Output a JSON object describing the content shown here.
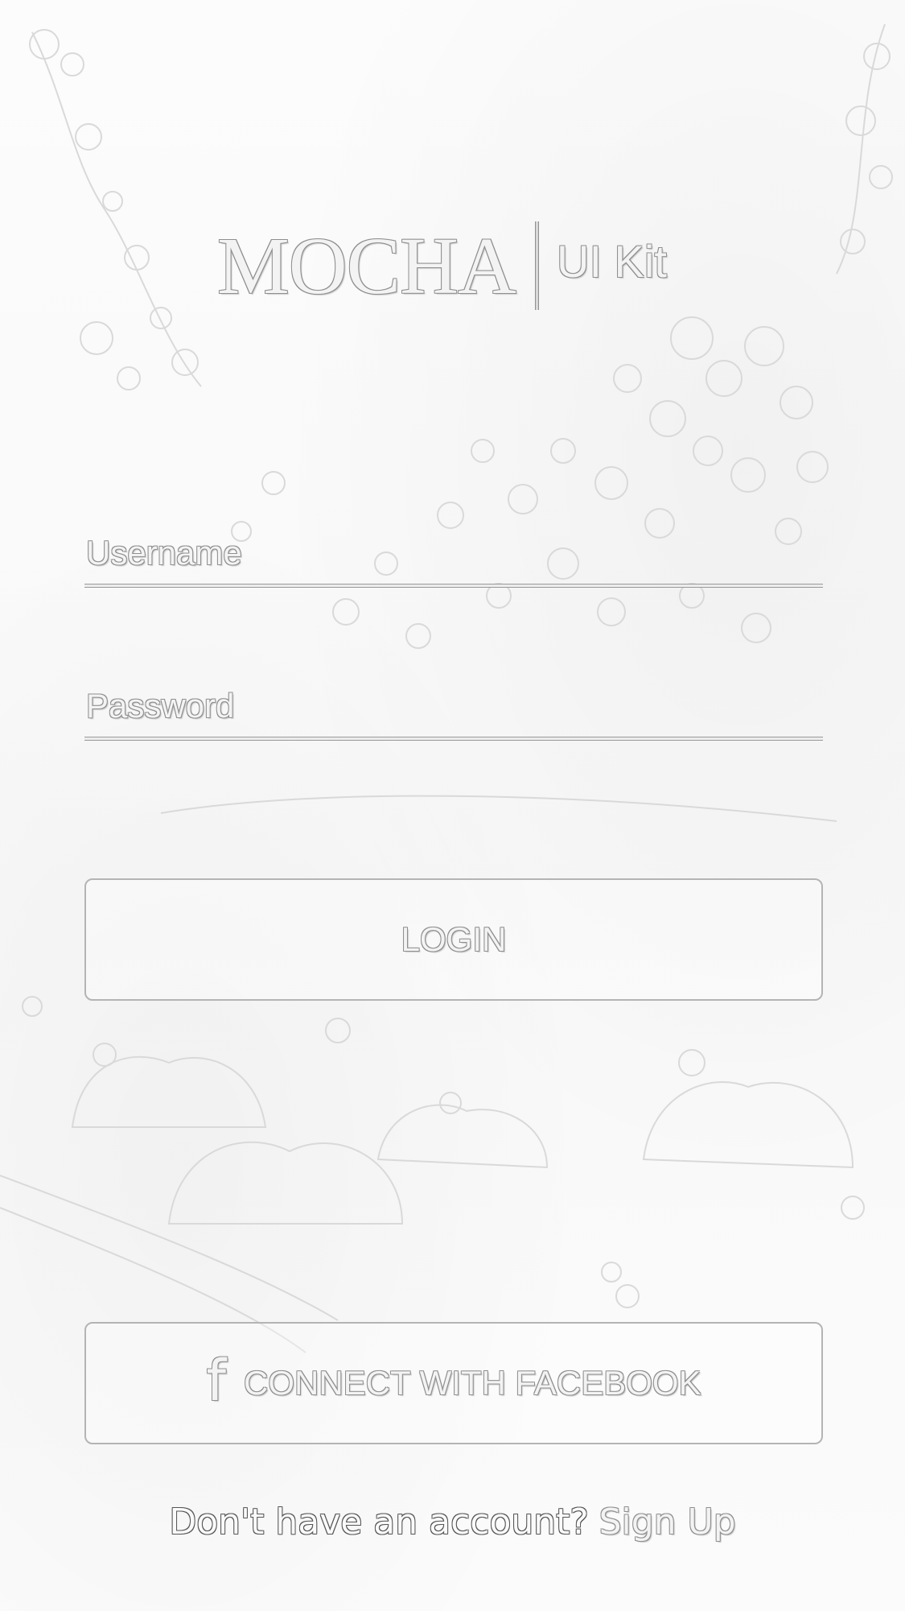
{
  "brand": {
    "name": "MOCHA",
    "subtitle": "UI Kit"
  },
  "form": {
    "username": {
      "placeholder": "Username",
      "value": ""
    },
    "password": {
      "placeholder": "Password",
      "value": ""
    }
  },
  "login_button": {
    "label": "LOGIN"
  },
  "facebook_button": {
    "icon": "facebook-icon",
    "icon_glyph": "f",
    "label": "CONNECT WITH FACEBOOK"
  },
  "signup": {
    "prompt": "Don't have an account?",
    "link": "Sign Up"
  }
}
